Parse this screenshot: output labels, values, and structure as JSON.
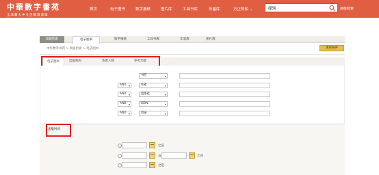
{
  "colors": {
    "brand": "#e05f42",
    "accent": "#e7bd4d",
    "highlight": "#e02020"
  },
  "header": {
    "logo_title": "中華數字書苑",
    "logo_subtitle": "全球最大中文正版資源庫",
    "nav": [
      "首页",
      "电子图书",
      "数字报纸",
      "图片库",
      "工具书库",
      "年鉴库",
      "方正阿帕"
    ],
    "search_value": "绿翎",
    "search_icon": "search-icon",
    "advanced_search": "高级检索"
  },
  "tabs": [
    "高级检索",
    "电子图书",
    "数字报纸",
    "工具书库",
    "年鉴库",
    "图片库"
  ],
  "breadcrumb": [
    "中华数字书苑",
    "高级检索",
    "电子图书"
  ],
  "reset_label": "清空条件",
  "subtabs": [
    "电子图书",
    "出版机构",
    "作者人物",
    "参考文献"
  ],
  "search_rows": [
    {
      "op": "",
      "field": "书名"
    },
    {
      "op": "AND",
      "field": "作者"
    },
    {
      "op": "AND",
      "field": "出版社"
    },
    {
      "op": "AND",
      "field": "ISBN"
    },
    {
      "op": "AND",
      "field": "目录"
    }
  ],
  "pub_time": {
    "title": "出版时间",
    "before": "之前",
    "and": "与",
    "between": "之间",
    "after": "之后"
  }
}
